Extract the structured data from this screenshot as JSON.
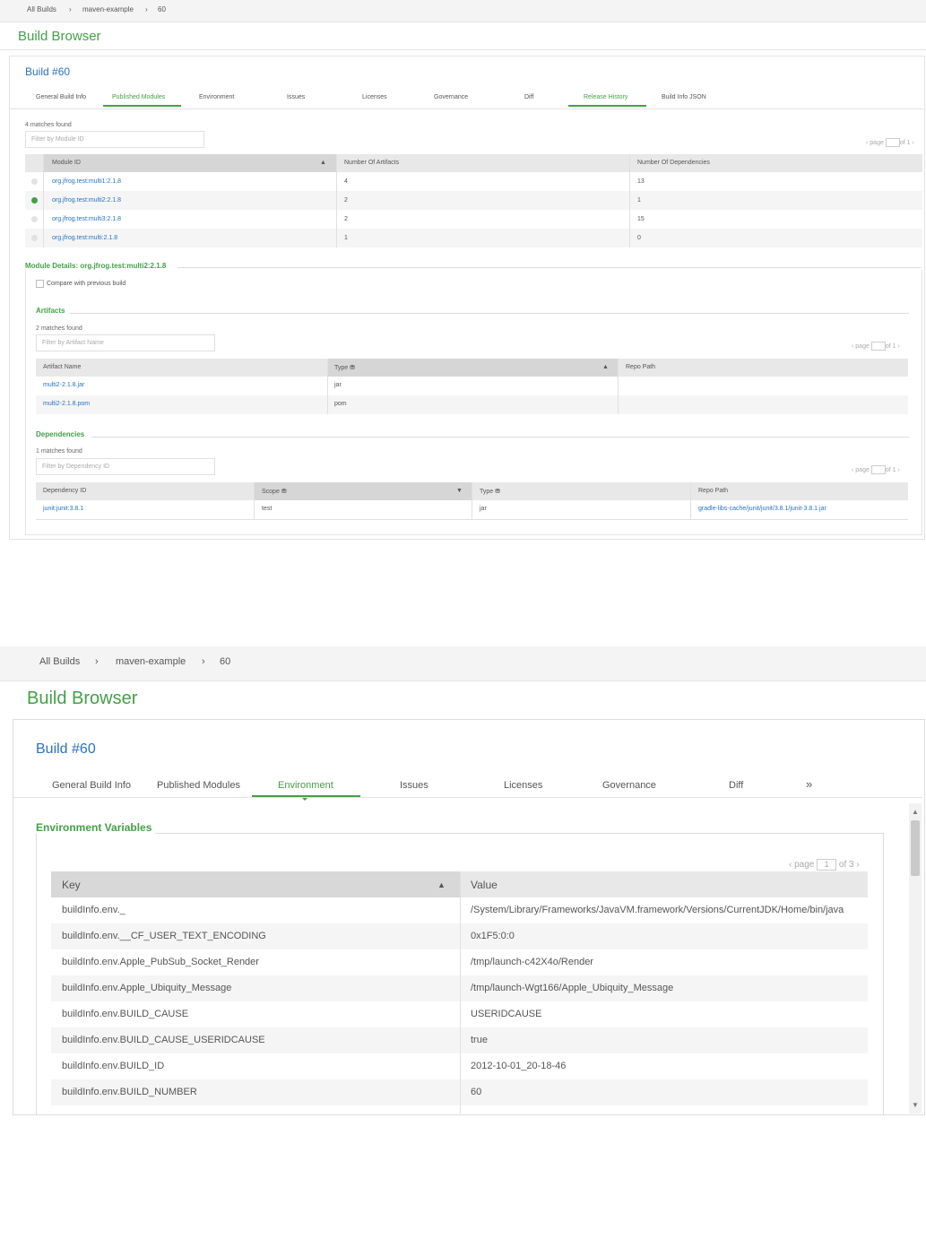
{
  "top": {
    "breadcrumb": [
      "All Builds",
      "maven-example",
      "60"
    ],
    "page_title": "Build Browser",
    "build_title": "Build #60",
    "tabs": [
      "General Build Info",
      "Published Modules",
      "Environment",
      "Issues",
      "Licenses",
      "Governance",
      "Diff",
      "Release History",
      "Build Info JSON"
    ],
    "active_tab": "Published Modules",
    "modules": {
      "matches": "4 matches found",
      "filter_placeholder": "Filter by Module ID",
      "pager": {
        "prefix": "page",
        "page": "1",
        "suffix": "of 1"
      },
      "columns": [
        "Module ID",
        "Number Of Artifacts",
        "Number Of Dependencies"
      ],
      "rows": [
        {
          "id": "org.jfrog.test:multi1:2.1.8",
          "artifacts": "4",
          "deps": "13",
          "selected": false
        },
        {
          "id": "org.jfrog.test:multi2:2.1.8",
          "artifacts": "2",
          "deps": "1",
          "selected": true
        },
        {
          "id": "org.jfrog.test:multi3:2.1.8",
          "artifacts": "2",
          "deps": "15",
          "selected": false
        },
        {
          "id": "org.jfrog.test:multi:2.1.8",
          "artifacts": "1",
          "deps": "0",
          "selected": false
        }
      ]
    },
    "module_details": {
      "title": "Module Details: org.jfrog.test:multi2:2.1.8",
      "compare_label": "Compare with previous build",
      "artifacts": {
        "title": "Artifacts",
        "matches": "2 matches found",
        "filter_placeholder": "Filter by Artifact Name",
        "pager": {
          "prefix": "page",
          "page": "1",
          "suffix": "of 1"
        },
        "columns": [
          "Artifact Name",
          "Type",
          "Repo Path"
        ],
        "rows": [
          {
            "name": "multi2-2.1.8.jar",
            "type": "jar",
            "path": ""
          },
          {
            "name": "multi2-2.1.8.pom",
            "type": "pom",
            "path": ""
          }
        ]
      },
      "dependencies": {
        "title": "Dependencies",
        "matches": "1 matches found",
        "filter_placeholder": "Filter by Dependency ID",
        "pager": {
          "prefix": "page",
          "page": "1",
          "suffix": "of 1"
        },
        "columns": [
          "Dependency ID",
          "Scope",
          "Type",
          "Repo Path"
        ],
        "rows": [
          {
            "id": "junit:junit:3.8.1",
            "scope": "test",
            "type": "jar",
            "path": "gradle-libs-cache/junit/junit/3.8.1/junit-3.8.1.jar"
          }
        ]
      }
    }
  },
  "bottom": {
    "breadcrumb": [
      "All Builds",
      "maven-example",
      "60"
    ],
    "page_title": "Build Browser",
    "build_title": "Build #60",
    "tabs": [
      "General Build Info",
      "Published Modules",
      "Environment",
      "Issues",
      "Licenses",
      "Governance",
      "Diff"
    ],
    "more_tabs": "»",
    "active_tab": "Environment",
    "env_title": "Environment Variables",
    "pager": {
      "prefix": "page",
      "page": "1",
      "suffix": "of 3"
    },
    "columns": [
      "Key",
      "Value"
    ],
    "rows": [
      {
        "key": "buildInfo.env._",
        "value": "/System/Library/Frameworks/JavaVM.framework/Versions/CurrentJDK/Home/bin/java"
      },
      {
        "key": "buildInfo.env.__CF_USER_TEXT_ENCODING",
        "value": "0x1F5:0:0"
      },
      {
        "key": "buildInfo.env.Apple_PubSub_Socket_Render",
        "value": "/tmp/launch-c42X4o/Render"
      },
      {
        "key": "buildInfo.env.Apple_Ubiquity_Message",
        "value": "/tmp/launch-Wgt166/Apple_Ubiquity_Message"
      },
      {
        "key": "buildInfo.env.BUILD_CAUSE",
        "value": "USERIDCAUSE"
      },
      {
        "key": "buildInfo.env.BUILD_CAUSE_USERIDCAUSE",
        "value": "true"
      },
      {
        "key": "buildInfo.env.BUILD_ID",
        "value": "2012-10-01_20-18-46"
      },
      {
        "key": "buildInfo.env.BUILD_NUMBER",
        "value": "60"
      }
    ]
  },
  "colors": {
    "brand_green": "#43a047",
    "link_blue": "#2a72c1"
  }
}
